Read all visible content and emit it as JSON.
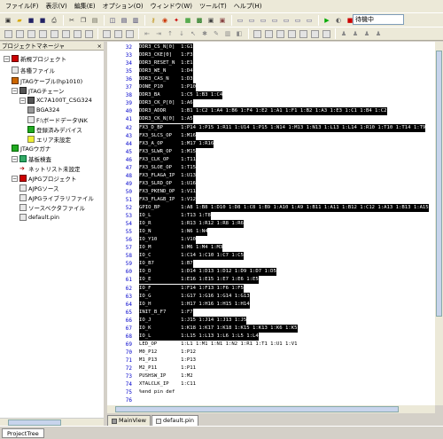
{
  "menu": [
    "ファイル(F)",
    "表示(V)",
    "編集(E)",
    "オプション(O)",
    "ウィンドウ(W)",
    "ツール(T)",
    "ヘルプ(H)"
  ],
  "status": {
    "text": "待機中"
  },
  "toolbar1": [
    {
      "name": "new-project-icon",
      "g": "▣",
      "c": "#333"
    },
    {
      "name": "open-folder-icon",
      "g": "▰",
      "c": "#d8a800"
    },
    {
      "name": "save-icon",
      "g": "■",
      "c": "#226"
    },
    {
      "name": "save-all-icon",
      "g": "■",
      "c": "#226"
    },
    {
      "name": "print-icon",
      "g": "⎙",
      "c": "#333"
    },
    {
      "sep": true
    },
    {
      "name": "cut-icon",
      "g": "✂",
      "c": "#333"
    },
    {
      "name": "copy-icon",
      "g": "❐",
      "c": "#333"
    },
    {
      "name": "paste-icon",
      "g": "▤",
      "c": "#665"
    },
    {
      "sep": true
    },
    {
      "name": "layout-split-icon",
      "g": "◫",
      "c": "#336"
    },
    {
      "name": "layout-window-icon",
      "g": "▤",
      "c": "#336"
    },
    {
      "name": "layout-columns-icon",
      "g": "▥",
      "c": "#336"
    },
    {
      "sep": true
    },
    {
      "name": "key-icon",
      "g": "⚷",
      "c": "#b80"
    },
    {
      "name": "target-icon",
      "g": "◉",
      "c": "#c30"
    },
    {
      "name": "new-badge-icon",
      "g": "✦",
      "c": "#c00"
    },
    {
      "name": "config-icon",
      "g": "▦",
      "c": "#080"
    },
    {
      "name": "board-icon",
      "g": "▩",
      "c": "#060"
    },
    {
      "name": "chip-icon",
      "g": "▣",
      "c": "#444"
    },
    {
      "name": "chip-alt-icon",
      "g": "▣",
      "c": "#844"
    },
    {
      "sep": true
    },
    {
      "name": "bar-toggle-1-icon",
      "g": "▭",
      "c": "#558"
    },
    {
      "name": "bar-toggle-2-icon",
      "g": "▭",
      "c": "#558"
    },
    {
      "name": "bar-toggle-3-icon",
      "g": "▭",
      "c": "#558"
    },
    {
      "name": "bar-toggle-4-icon",
      "g": "▭",
      "c": "#558"
    },
    {
      "name": "bar-toggle-5-icon",
      "g": "▭",
      "c": "#558"
    },
    {
      "name": "bar-toggle-6-icon",
      "g": "▭",
      "c": "#558"
    },
    {
      "name": "bar-toggle-7-icon",
      "g": "▭",
      "c": "#558"
    },
    {
      "sep": true
    },
    {
      "name": "run-icon",
      "g": "▶",
      "c": "#0a0"
    },
    {
      "name": "pause-icon",
      "g": "◐",
      "c": "#666"
    },
    {
      "name": "stop-icon",
      "g": "■",
      "c": "#c00"
    }
  ],
  "toolbar2": [
    {
      "name": "grid-1-icon",
      "box": true
    },
    {
      "name": "grid-2-icon",
      "box": true
    },
    {
      "name": "grid-3-icon",
      "box": true
    },
    {
      "name": "grid-4-icon",
      "box": true
    },
    {
      "name": "grid-5-icon",
      "box": true
    },
    {
      "name": "grid-6-icon",
      "box": true
    },
    {
      "name": "grid-7-icon",
      "box": true
    },
    {
      "name": "grid-8-icon",
      "box": true
    },
    {
      "sep": true
    },
    {
      "name": "grid-9-icon",
      "box": true
    },
    {
      "name": "grid-10-icon",
      "box": true
    },
    {
      "name": "grid-11-icon",
      "box": true
    },
    {
      "sep": true
    },
    {
      "name": "indent-icon",
      "g": "⇤",
      "c": "#888"
    },
    {
      "name": "outdent-icon",
      "g": "⇥",
      "c": "#888"
    },
    {
      "name": "arrow-up-icon",
      "g": "↑",
      "c": "#888"
    },
    {
      "name": "arrow-down-icon",
      "g": "↓",
      "c": "#888"
    },
    {
      "name": "arrow-diag-icon",
      "g": "↖",
      "c": "#888"
    },
    {
      "name": "tool-a-icon",
      "g": "✱",
      "c": "#888"
    },
    {
      "name": "tool-b-icon",
      "g": "✎",
      "c": "#888"
    },
    {
      "name": "tool-c-icon",
      "g": "▥",
      "c": "#888"
    },
    {
      "name": "tool-d-icon",
      "g": "◧",
      "c": "#888"
    },
    {
      "sep": true
    },
    {
      "name": "grid-12-icon",
      "box": true
    },
    {
      "name": "grid-13-icon",
      "box": true
    },
    {
      "name": "grid-14-icon",
      "box": true
    },
    {
      "name": "grid-15-icon",
      "box": true
    },
    {
      "name": "grid-16-icon",
      "box": true
    },
    {
      "name": "grid-17-icon",
      "box": true
    },
    {
      "name": "grid-18-icon",
      "box": true
    },
    {
      "sep": true
    },
    {
      "name": "user-a-icon",
      "g": "♟",
      "c": "#888"
    },
    {
      "name": "user-b-icon",
      "g": "♟",
      "c": "#888"
    },
    {
      "name": "user-c-icon",
      "g": "♟",
      "c": "#888"
    },
    {
      "name": "user-d-icon",
      "g": "♟",
      "c": "#888"
    }
  ],
  "project_panel": {
    "title": "プロジェクトマネージャ",
    "close": "×",
    "tree": [
      {
        "label": "新規プロジェクト",
        "indent": 0,
        "expand": "−",
        "icon": "ic-proj",
        "name": "tree-item-new-project"
      },
      {
        "label": "各種ファイル",
        "indent": 1,
        "expand": "",
        "icon": "ic-doc",
        "name": "tree-item-files"
      },
      {
        "label": "JTAGケーブル(hp1010)",
        "indent": 1,
        "expand": "",
        "icon": "ic-cable",
        "name": "tree-item-jtag-cable"
      },
      {
        "label": "JTAGチェーン",
        "indent": 1,
        "expand": "−",
        "icon": "ic-chip",
        "name": "tree-item-jtag-chain"
      },
      {
        "label": "XC7A100T_CSG324",
        "indent": 2,
        "expand": "−",
        "icon": "ic-chip",
        "name": "tree-item-device"
      },
      {
        "label": "BGA324",
        "indent": 3,
        "expand": "",
        "icon": "ic-chip2",
        "name": "tree-item-bga324"
      },
      {
        "label": "F:\\ボードデータ\\NK",
        "indent": 3,
        "expand": "",
        "icon": "ic-doc",
        "name": "tree-item-board-data"
      },
      {
        "label": "登録済みデバイス",
        "indent": 3,
        "expand": "",
        "icon": "ic-green",
        "name": "tree-item-registered-device"
      },
      {
        "label": "エリア未設定",
        "indent": 3,
        "expand": "",
        "icon": "ic-yellow",
        "name": "tree-item-area"
      },
      {
        "label": "JTAGウガナ",
        "indent": 1,
        "expand": "",
        "icon": "ic-green",
        "name": "tree-item-jtag-wizard"
      },
      {
        "label": "基板検査",
        "indent": 1,
        "expand": "−",
        "icon": "ic-board",
        "name": "tree-item-board-test"
      },
      {
        "label": "ネットリスト未設定",
        "indent": 2,
        "expand": "",
        "icon": "ic-arrow",
        "name": "tree-item-netlist"
      },
      {
        "label": "AJPGプロジェクト",
        "indent": 1,
        "expand": "−",
        "icon": "ic-proj",
        "name": "tree-item-ajpg-project"
      },
      {
        "label": "AJPGソース",
        "indent": 2,
        "expand": "",
        "icon": "ic-doc",
        "name": "tree-item-ajpg-source"
      },
      {
        "label": "AJPGライブラリファイル",
        "indent": 2,
        "expand": "",
        "icon": "ic-doc",
        "name": "tree-item-ajpg-library"
      },
      {
        "label": "ソースベクタファイル",
        "indent": 2,
        "expand": "",
        "icon": "ic-doc",
        "name": "tree-item-source-vector"
      },
      {
        "label": "default.pin",
        "indent": 2,
        "expand": "",
        "icon": "ic-doc",
        "name": "tree-item-default-pin"
      }
    ]
  },
  "editor": {
    "lines": [
      {
        "n": "32",
        "text": "DDR3_CS_N[0]  1:G1",
        "sel": true
      },
      {
        "n": "33",
        "text": "DDR3_CKE[0]   1:F3",
        "sel": true
      },
      {
        "n": "34",
        "text": "DDR3_RESET_N  1:E1",
        "sel": true
      },
      {
        "n": "35",
        "text": "DDR3_WE_N     1:D4",
        "sel": true
      },
      {
        "n": "36",
        "text": "DDR3_CAS_N    1:D3",
        "sel": true
      },
      {
        "n": "37",
        "text": "DONE_P10      1:P10",
        "sel": true
      },
      {
        "n": "38",
        "text": "DDR3_BA       1:C5 1:B3 1:C4",
        "sel": true
      },
      {
        "n": "39",
        "text": "DDR3_CK_P[0]  1:A6",
        "sel": true
      },
      {
        "n": "40",
        "text": "DDR3_ADDR     1:B1 1:C2 1:A4 1:B6 1:F4 1:E2 1:A1 1:F1 1:B2 1:A3 1:E3 1:C1 1:B4 1:C2",
        "sel": true
      },
      {
        "n": "41",
        "text": "DDR3_CK_N[0]  1:A5",
        "sel": true
      },
      {
        "n": "42",
        "text": "FX3_D_BP      1:P14 1:P15 1:R11 1:U14 1:P15 1:N14 1:M13 1:N13 1:L13 1:L14 1:R10 1:T10 1:T14 1:T9",
        "sel": true
      },
      {
        "n": "43",
        "text": "FX3_SLCS_OP   1:M16",
        "sel": true
      },
      {
        "n": "44",
        "text": "FX3_A_OP      1:M17 1:R16",
        "sel": true
      },
      {
        "n": "45",
        "text": "FX3_SLWR_OP   1:M15",
        "sel": true
      },
      {
        "n": "46",
        "text": "FX3_CLK_OP    1:T11",
        "sel": true
      },
      {
        "n": "47",
        "text": "FX3_SLOE_OP   1:T15",
        "sel": true
      },
      {
        "n": "48",
        "text": "FX3_FLAGA_IP  1:U13",
        "sel": true
      },
      {
        "n": "49",
        "text": "FX3_SLRD_OP   1:U16",
        "sel": true
      },
      {
        "n": "50",
        "text": "FX3_PKEND_OP  1:V11",
        "sel": true
      },
      {
        "n": "51",
        "text": "FX3_FLAGB_IP  1:V12",
        "sel": true
      },
      {
        "n": "52",
        "text": "GPIO_BP       1:A8 1:B8 1:D10 1:D8 1:C8 1:B9 1:A10 1:A9 1:B11 1:A11 1:B12 1:C12 1:A13 1:B13 1:A15",
        "sel": true
      },
      {
        "n": "53",
        "text": "IO_L          1:T13 1:T8",
        "sel": true
      },
      {
        "n": "54",
        "text": "IO_R          1:R13 1:R12 1:R8 1:R6",
        "sel": true
      },
      {
        "n": "55",
        "text": "IO_N          1:N6 1:N4",
        "sel": true
      },
      {
        "n": "56",
        "text": "IO_Y10        1:V10",
        "sel": true
      },
      {
        "n": "57",
        "text": "IO_M          1:M6 1:M4 1:M3",
        "sel": true
      },
      {
        "n": "58",
        "text": "IO_C          1:C14 1:C10 1:C7 1:C5",
        "sel": true
      },
      {
        "n": "59",
        "text": "IO_B7         1:B7",
        "sel": true
      },
      {
        "n": "60",
        "text": "IO_D          1:D14 1:D13 1:D12 1:D9 1:D7 1:D5",
        "sel": true
      },
      {
        "n": "61",
        "text": "IO_E          1:E16 1:E15 1:E7 1:E6 1:E5",
        "sel": true
      },
      {
        "n": "62",
        "text": "IO_F          1:F14 1:F13 1:F6 1:F5",
        "sel": true
      },
      {
        "n": "63",
        "text": "IO_G          1:G17 1:G16 1:G14 1:G13",
        "sel": true
      },
      {
        "n": "64",
        "text": "IO_H          1:H17 1:H16 1:H15 1:H14",
        "sel": true
      },
      {
        "n": "65",
        "text": "INIT_B_F7     1:F7",
        "sel": true
      },
      {
        "n": "66",
        "text": "IO_J          1:J15 1:J14 1:J13 1:J5",
        "sel": true
      },
      {
        "n": "67",
        "text": "IO_K          1:K18 1:K17 1:K18 1:K15 1:K13 1:K6 1:K5",
        "sel": true
      },
      {
        "n": "68",
        "text": "IO_L          1:L15 1:L13 1:L6 1:L5 1:L4",
        "sel": true
      },
      {
        "n": "69",
        "text": "LED_OP        1:L1 1:M1 1:N1 1:N2 1:R1 1:T1 1:U1 1:V1",
        "sel": false
      },
      {
        "n": "70",
        "text": "M0_P12        1:P12",
        "sel": false
      },
      {
        "n": "71",
        "text": "M1_P13        1:P13",
        "sel": false
      },
      {
        "n": "72",
        "text": "M2_P11        1:P11",
        "sel": false
      },
      {
        "n": "73",
        "text": "PUSHSW_IP     1:M2",
        "sel": false
      },
      {
        "n": "74",
        "text": "XTALCLK_IP    1:C11",
        "sel": false
      },
      {
        "n": "75",
        "text": "%end pin def",
        "sel": false
      },
      {
        "n": "76",
        "text": "",
        "sel": false
      }
    ]
  },
  "tabs": [
    {
      "label": "MainView",
      "active": false,
      "name": "tab-mainview"
    },
    {
      "label": "default.pin",
      "active": true,
      "name": "tab-default-pin"
    }
  ],
  "bottom_tab": "ProjectTree"
}
